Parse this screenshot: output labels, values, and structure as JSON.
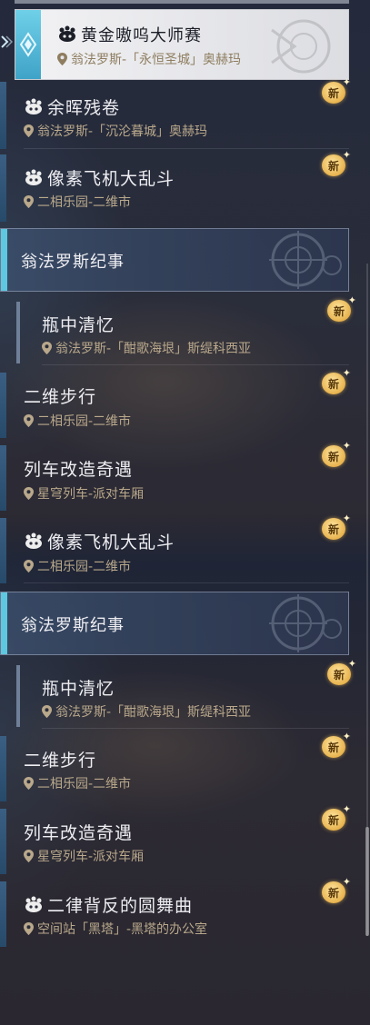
{
  "selected": {
    "title": "黄金嗷呜大师赛",
    "location": "翁法罗斯-「永恒圣城」奥赫玛"
  },
  "items": [
    {
      "title": "余晖残卷",
      "location": "翁法罗斯-「沉沦暮城」奥赫玛",
      "badge": "新"
    },
    {
      "title": "像素飞机大乱斗",
      "location": "二相乐园-二维市",
      "badge": "新"
    },
    {
      "title": "瓶中清忆",
      "location": "翁法罗斯-「酣歌海垠」斯缇科西亚",
      "badge": "新"
    },
    {
      "title": "二维步行",
      "location": "二相乐园-二维市",
      "badge": "新"
    },
    {
      "title": "列车改造奇遇",
      "location": "星穹列车-派对车厢",
      "badge": "新"
    },
    {
      "title": "像素飞机大乱斗",
      "location": "二相乐园-二维市",
      "badge": "新"
    },
    {
      "title": "瓶中清忆",
      "location": "翁法罗斯-「酣歌海垠」斯缇科西亚",
      "badge": "新"
    },
    {
      "title": "二维步行",
      "location": "二相乐园-二维市",
      "badge": "新"
    },
    {
      "title": "列车改造奇遇",
      "location": "星穹列车-派对车厢",
      "badge": "新"
    },
    {
      "title": "二律背反的圆舞曲",
      "location": "空间站「黑塔」-黑塔的办公室",
      "badge": "新"
    }
  ],
  "categories": [
    {
      "title": "翁法罗斯纪事"
    },
    {
      "title": "翁法罗斯纪事"
    }
  ],
  "colors": {
    "accent": "#5ec8e0",
    "location_text": "#b9a88b",
    "badge": "#e7b24c"
  }
}
